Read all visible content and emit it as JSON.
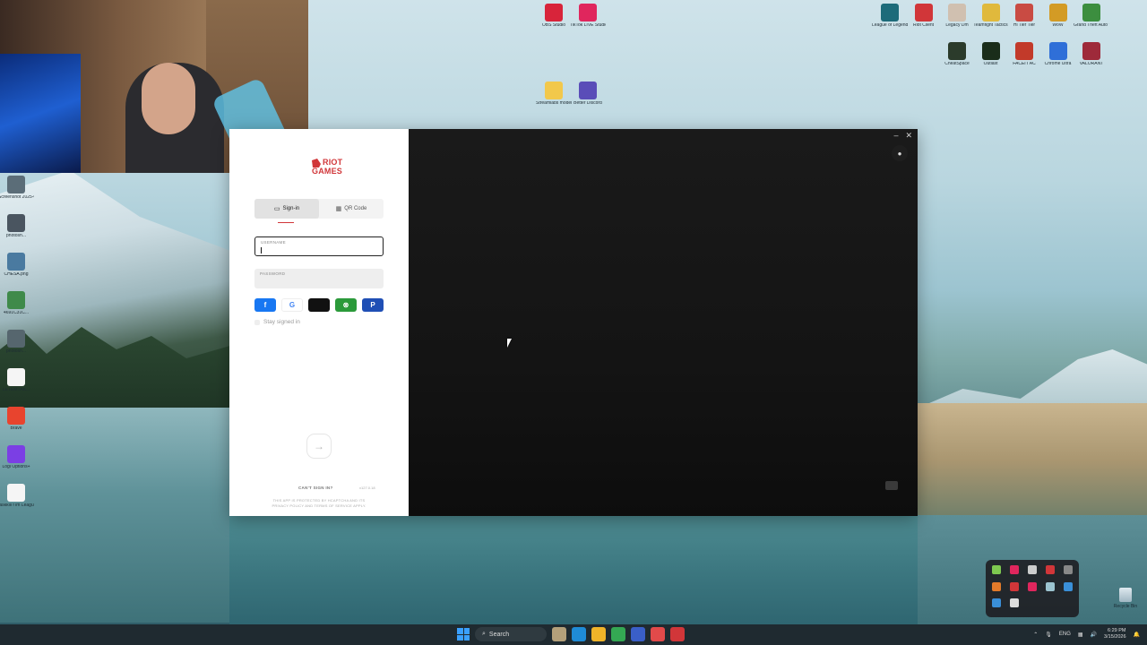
{
  "desktop": {
    "icons_top": [
      {
        "label": "OBS Studio",
        "color": "#d8243a"
      },
      {
        "label": "TikTok LIVE Studio",
        "color": "#e0265d"
      }
    ],
    "icons_mid": [
      {
        "label": "Streamlabs moderator",
        "color": "#f2c84b"
      },
      {
        "label": "Better Discord",
        "color": "#5a4db8"
      }
    ],
    "icons_right_row1": [
      {
        "label": "League of Legends",
        "color": "#1d6b7a"
      },
      {
        "label": "Riot Client",
        "color": "#d13639"
      },
      {
        "label": "Legacy Dm",
        "color": "#d0c0b0"
      },
      {
        "label": "Teamfight Tactics",
        "color": "#e0b93c"
      },
      {
        "label": "Hi Tier Tier",
        "color": "#c94b43"
      },
      {
        "label": "WoW",
        "color": "#d39b25"
      },
      {
        "label": "Grand Theft Auto V",
        "color": "#3c8e3f"
      }
    ],
    "icons_right_row2": [
      {
        "label": "CheatSpace",
        "color": "#2b3b2b"
      },
      {
        "label": "Outlast",
        "color": "#1a2d1a"
      },
      {
        "label": "FACEIT AC",
        "color": "#c23a2a"
      },
      {
        "label": "Chrome Ultra",
        "color": "#2f6fd8"
      },
      {
        "label": "VALORANT",
        "color": "#9e2a3a"
      }
    ],
    "icons_left": [
      {
        "label": "Screenshot 2025-0...",
        "color": "#5b6d78"
      },
      {
        "label": "photosh...",
        "color": "#4a5560"
      },
      {
        "label": "CHESA.png",
        "color": "#4a7aa0"
      },
      {
        "label": "4691C31C...",
        "color": "#3f8a4a"
      },
      {
        "label": "photosh...",
        "color": "#56666e"
      },
      {
        "label": "LETEMTAK...",
        "color": "#f5f5f5"
      },
      {
        "label": "Brave",
        "color": "#e8442e"
      },
      {
        "label": "Logi Options+",
        "color": "#7b3fe4"
      },
      {
        "label": "taskkill f im LeagueClie...",
        "color": "#f5f5f5"
      }
    ],
    "recycle_bin": "Recycle Bin"
  },
  "riot": {
    "logo_line1": "RIOT",
    "logo_line2": "GAMES",
    "tabs": [
      {
        "label": "Sign-in",
        "icon": "id-card-icon"
      },
      {
        "label": "QR Code",
        "icon": "qr-code-icon"
      }
    ],
    "username_label": "USERNAME",
    "password_label": "PASSWORD",
    "socials": [
      {
        "name": "facebook",
        "glyph": "f",
        "color": "#1877f2"
      },
      {
        "name": "google",
        "glyph": "G",
        "color": "#ffffff"
      },
      {
        "name": "apple",
        "glyph": "",
        "color": "#111111"
      },
      {
        "name": "xbox",
        "glyph": "⊗",
        "color": "#2b9a3a"
      },
      {
        "name": "playstation",
        "glyph": "P",
        "color": "#1f4fb5"
      }
    ],
    "stay_signed_in": "Stay signed in",
    "cant_sign_in": "CAN'T SIGN IN?",
    "version": "v127.0.18",
    "legal_line1": "THIS APP IS PROTECTED BY HCAPTCHA AND ITS",
    "legal_line2": "PRIVACY POLICY AND TERMS OF SERVICE APPLY.",
    "accent": "#d13639"
  },
  "taskbar": {
    "search": "Search",
    "lang": "ENG",
    "time": "6:29 PM",
    "date": "3/15/2026"
  }
}
